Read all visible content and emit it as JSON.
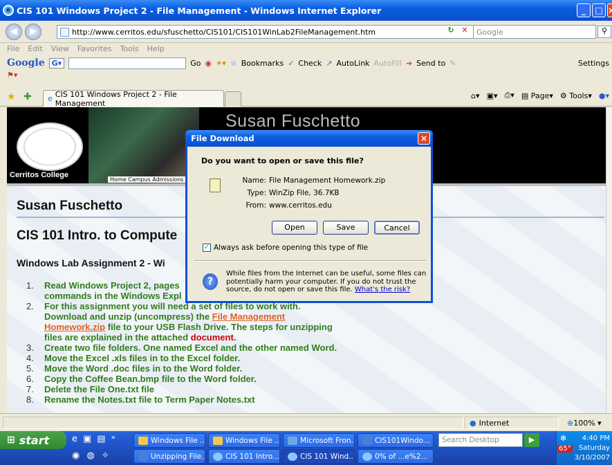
{
  "window": {
    "title": "CIS 101 Windows Project 2 - File Management - Windows Internet Explorer"
  },
  "address": {
    "url": "http://www.cerritos.edu/sfuschetto/CIS101/CIS101WinLab2FileManagement.htm",
    "search_placeholder": "Google"
  },
  "menu": [
    "File",
    "Edit",
    "View",
    "Favorites",
    "Tools",
    "Help"
  ],
  "google_toolbar": {
    "logo": "Google",
    "go": "Go",
    "bookmarks": "Bookmarks",
    "check": "Check",
    "autolink": "AutoLink",
    "autofill": "AutoFill",
    "send_to": "Send to",
    "settings": "Settings"
  },
  "tab": {
    "label": "CIS 101 Windows Project 2 - File Management"
  },
  "command_bar": {
    "page": "Page",
    "tools": "Tools"
  },
  "page": {
    "site_name": "Susan Fuschetto",
    "college": "Cerritos College",
    "nav": "Home  Campus  Admissions",
    "heading_name": "Susan Fuschetto",
    "heading_course": "CIS 101 Intro. to Compute",
    "heading_lab": "Windows Lab Assignment 2 - Wi",
    "list": [
      {
        "num": "1.",
        "text": "Read Windows Project 2, pages",
        "text2": "commands in the Windows Expl"
      },
      {
        "num": "2.",
        "pre": "For this assignment you will need a set of files to work with.",
        "line2": "Download and unzip (uncompress) the ",
        "link": "File Management",
        "link2": "Homework.zip",
        "post": " file to your USB Flash Drive.  The steps for unzipping",
        "line4": "files are explained in the attached ",
        "red": "document",
        "end": "."
      },
      {
        "num": "3.",
        "text": "Create two file folders.  One named Excel and the other named Word."
      },
      {
        "num": "4.",
        "text": "Move the Excel .xls files in to the Excel folder."
      },
      {
        "num": "5.",
        "text": "Move the Word .doc files in to the Word folder."
      },
      {
        "num": "6.",
        "text": "Copy the Coffee Bean.bmp file to the Word folder."
      },
      {
        "num": "7.",
        "text": "Delete the File One.txt file"
      },
      {
        "num": "8.",
        "text": "Rename the Notes.txt file to Term Paper Notes.txt"
      }
    ]
  },
  "dialog": {
    "title": "File Download",
    "question": "Do you want to open or save this file?",
    "name_label": "Name:",
    "name": "File Management Homework.zip",
    "type_label": "Type:",
    "type": "WinZip File, 36.7KB",
    "from_label": "From:",
    "from": "www.cerritos.edu",
    "open": "Open",
    "save": "Save",
    "cancel": "Cancel",
    "checkbox": "Always ask before opening this type of file",
    "warning": "While files from the Internet can be useful, some files can potentially harm your computer. If you do not trust the source, do not open or save this file. ",
    "risk_link": "What's the risk?"
  },
  "status": {
    "zone": "Internet",
    "zoom": "100%"
  },
  "taskbar": {
    "start": "start",
    "row1": [
      "Windows File ...",
      "Windows File ...",
      "Microsoft Fron...",
      "CIS101Windo..."
    ],
    "row2": [
      "Unzipping File...",
      "CIS 101 Intro....",
      "CIS 101 Wind...",
      "0% of ...e%2..."
    ],
    "search_placeholder": "Search Desktop",
    "time": "4:40 PM",
    "day": "Saturday",
    "date": "3/10/2007",
    "temp": "65°"
  }
}
